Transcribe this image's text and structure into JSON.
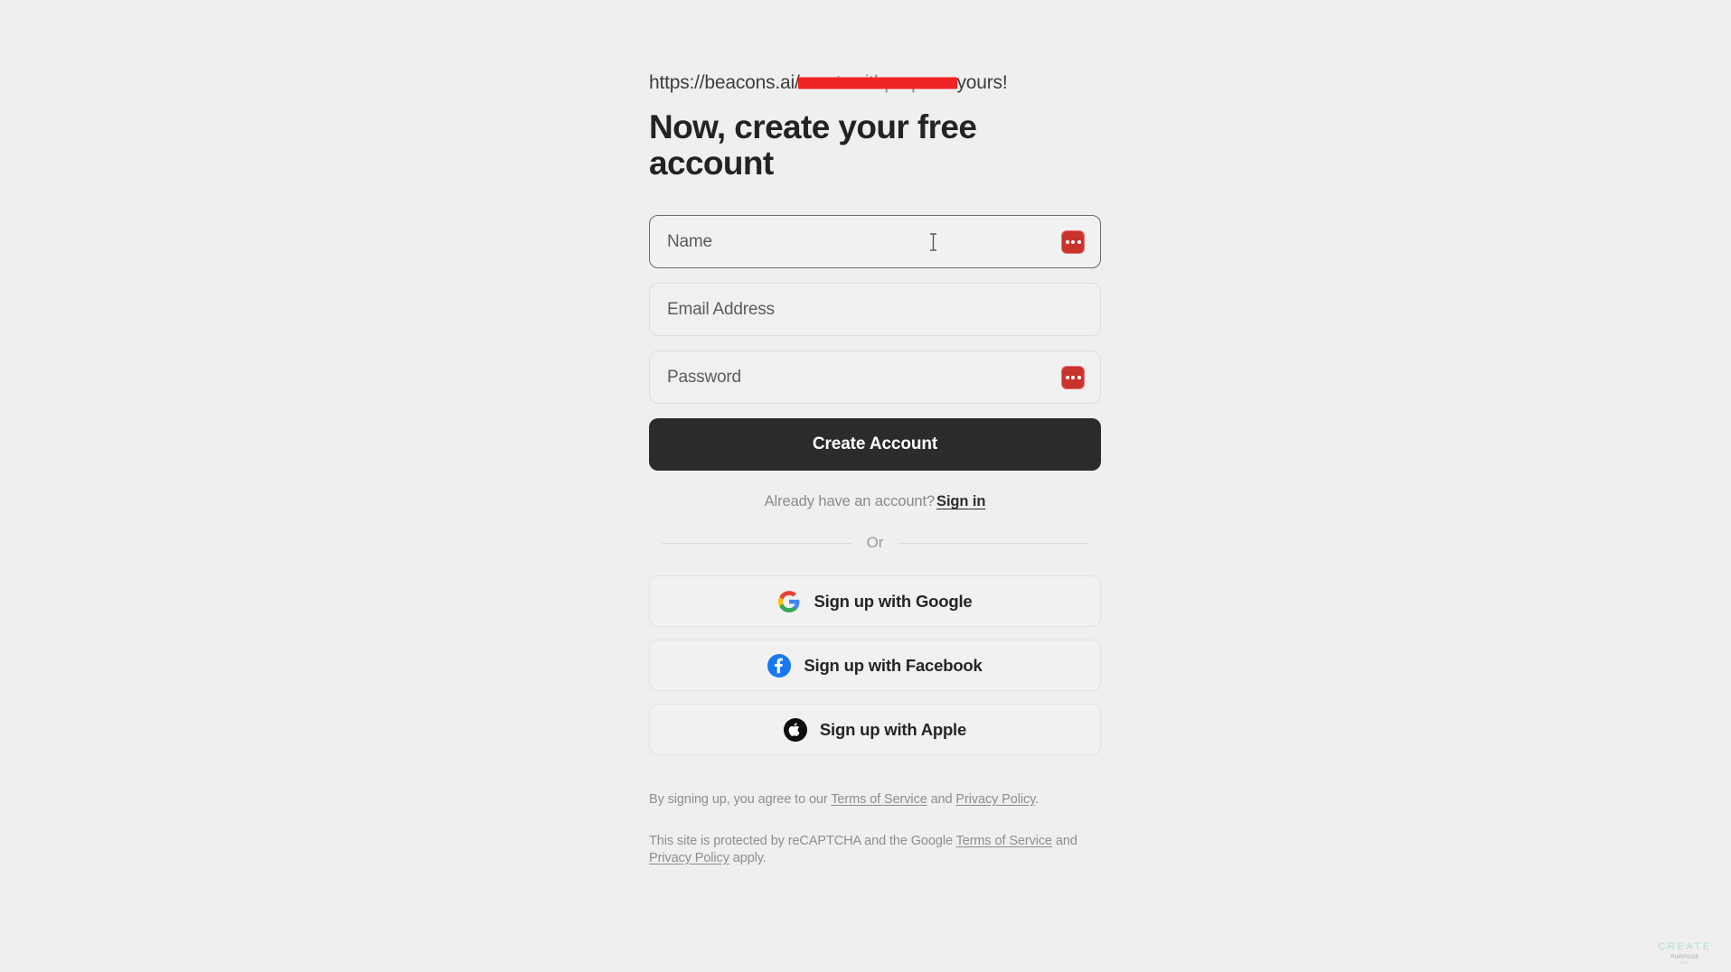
{
  "page": {
    "background_color": "#efefef"
  },
  "url_line": {
    "prefix": "https://beacons.ai/",
    "redacted_handle": "createwithpurpose",
    "suffix": " yours!",
    "strike_color": "#ef2424"
  },
  "heading": "Now, create your free account",
  "form": {
    "fields": [
      {
        "name": "name",
        "placeholder": "Name",
        "value": "",
        "focused": true,
        "has_password_manager_icon": true,
        "has_text_caret": true
      },
      {
        "name": "email",
        "placeholder": "Email Address",
        "value": "",
        "focused": false,
        "has_password_manager_icon": false,
        "has_text_caret": false
      },
      {
        "name": "password",
        "placeholder": "Password",
        "value": "",
        "focused": false,
        "has_password_manager_icon": true,
        "has_text_caret": false
      }
    ],
    "submit_label": "Create Account",
    "submit_color": "#2b2b2b"
  },
  "signin": {
    "prompt": "Already have an account?",
    "link_label": "Sign in"
  },
  "divider": {
    "label": "Or"
  },
  "social": {
    "buttons": [
      {
        "icon": "google-icon",
        "label": "Sign up with Google"
      },
      {
        "icon": "facebook-icon",
        "label": "Sign up with Facebook"
      },
      {
        "icon": "apple-icon",
        "label": "Sign up with Apple"
      }
    ]
  },
  "legal": {
    "terms_line": {
      "part1": "By signing up, you agree to our ",
      "link1": "Terms of Service",
      "part2": " and ",
      "link2": "Privacy Policy",
      "part3": "."
    },
    "recaptcha_line": {
      "part1": "This site is protected by reCAPTCHA and the Google ",
      "link1": "Terms of Service",
      "part2": " and ",
      "link2": "Privacy Policy",
      "part3": " apply."
    }
  },
  "watermark": {
    "title": "CREATE",
    "subtitle": "PURPOSE",
    "tagline": "with",
    "color": "#a5ddd0"
  }
}
